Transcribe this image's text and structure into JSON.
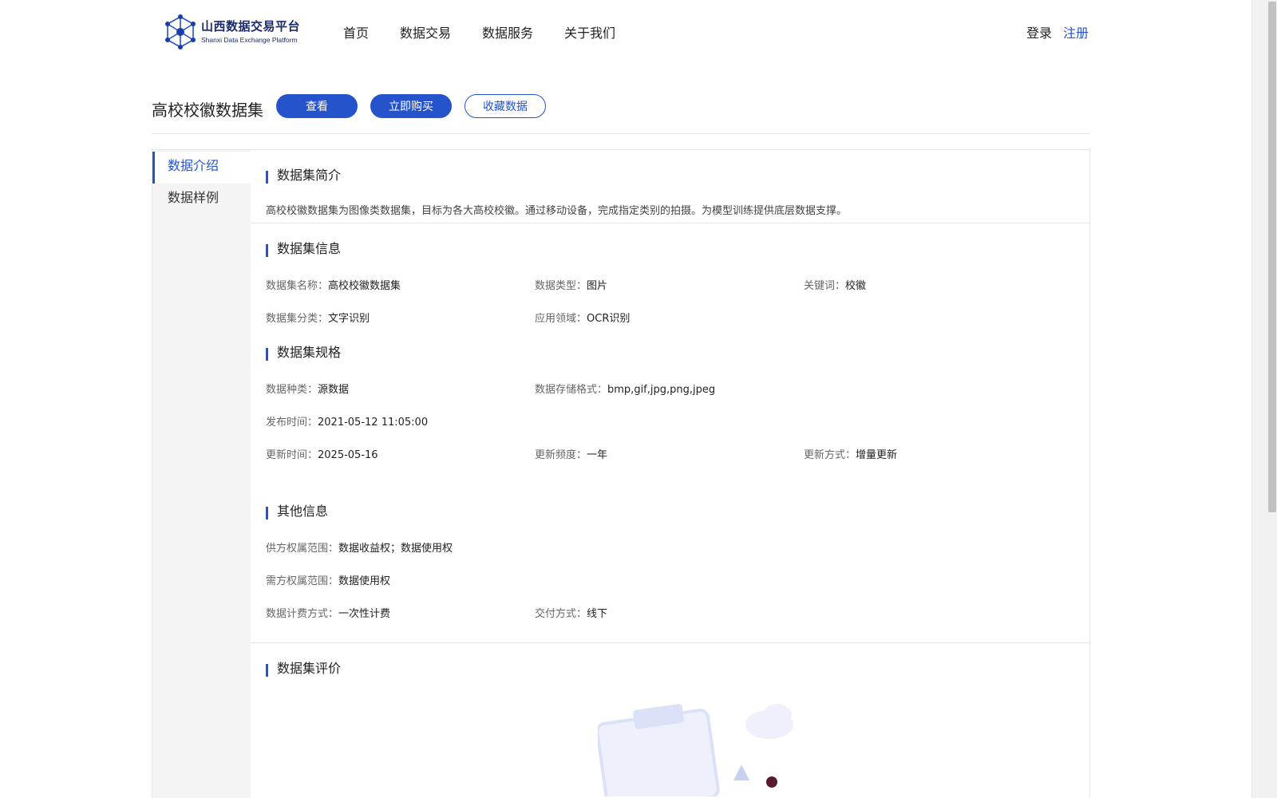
{
  "brand": {
    "name_cn": "山西数据交易平台",
    "name_en": "Shanxi Data Exchange Platform",
    "color": "#2553cc"
  },
  "nav": {
    "items": [
      "首页",
      "数据交易",
      "数据服务",
      "关于我们"
    ],
    "login": "登录",
    "register": "注册"
  },
  "title_bar": {
    "title": "高校校徽数据集",
    "view_btn": "查看",
    "buy_btn": "立即购买",
    "favorite_btn": "收藏数据"
  },
  "sidebar": {
    "items": [
      {
        "label": "数据介绍",
        "active": true
      },
      {
        "label": "数据样例",
        "active": false
      }
    ]
  },
  "intro": {
    "title": "数据集简介",
    "text": "高校校徽数据集为图像类数据集，目标为各大高校校徽。通过移动设备，完成指定类别的拍摄。为模型训练提供底层数据支撑。"
  },
  "info": {
    "title": "数据集信息",
    "name_label": "数据集名称：",
    "name_value": "高校校徽数据集",
    "type_label": "数据类型：",
    "type_value": "图片",
    "keyword_label": "关键词：",
    "keyword_value": "校徽",
    "category_label": "数据集分类：",
    "category_value": "文字识别",
    "domain_label": "应用领域：",
    "domain_value": "OCR识别"
  },
  "spec": {
    "title": "数据集规格",
    "kind_label": "数据种类：",
    "kind_value": "源数据",
    "format_label": "数据存储格式：",
    "format_value": "bmp,gif,jpg,png,jpeg",
    "publish_label": "发布时间：",
    "publish_value": "2021-05-12 11:05:00",
    "update_label": "更新时间：",
    "update_value": "2025-05-16",
    "freq_label": "更新频度：",
    "freq_value": "一年",
    "mode_label": "更新方式：",
    "mode_value": "增量更新"
  },
  "other": {
    "title": "其他信息",
    "supply_label": "供方权属范围：",
    "supply_value": "数据收益权；数据使用权",
    "demand_label": "需方权属范围：",
    "demand_value": "数据使用权",
    "billing_label": "数据计费方式：",
    "billing_value": "一次性计费",
    "delivery_label": "交付方式：",
    "delivery_value": "线下"
  },
  "review": {
    "title": "数据集评价"
  },
  "icons": {
    "logo": "hexagon-network-logo-icon",
    "empty": "empty-clipboard-illustration-icon"
  }
}
